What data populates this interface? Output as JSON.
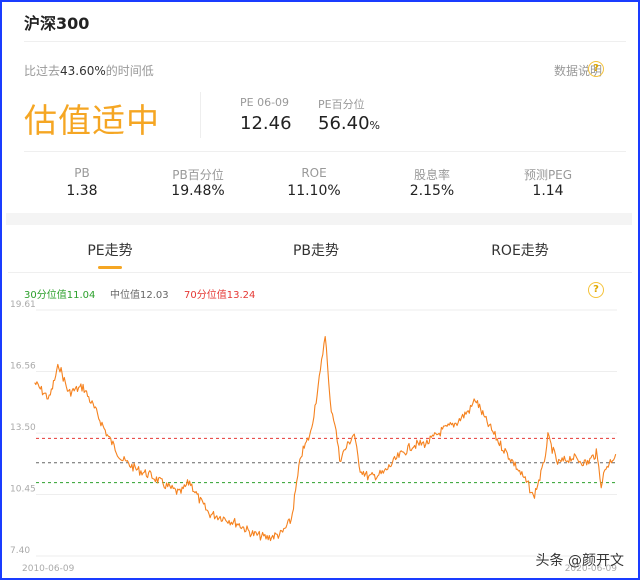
{
  "header": {
    "title": "沪深300"
  },
  "summary": {
    "compare_prefix": "比过去",
    "compare_value": "43.60%",
    "compare_suffix": "的时间低",
    "explain_label": "数据说明",
    "help_icon": "?",
    "verdict": "估值适中",
    "verdict_color": "#f5a623",
    "pe_label": "PE 06-09",
    "pe_value": "12.46",
    "pe_pct_label": "PE百分位",
    "pe_pct_value": "56.40",
    "pe_pct_unit": "%"
  },
  "metrics": [
    {
      "label": "PB",
      "value": "1.38"
    },
    {
      "label": "PB百分位",
      "value": "19.48%"
    },
    {
      "label": "ROE",
      "value": "11.10%"
    },
    {
      "label": "股息率",
      "value": "2.15%"
    },
    {
      "label": "预测PEG",
      "value": "1.14"
    }
  ],
  "tabs": [
    {
      "label": "PE走势",
      "active": true
    },
    {
      "label": "PB走势",
      "active": false
    },
    {
      "label": "ROE走势",
      "active": false
    }
  ],
  "legend": [
    {
      "text": "30分位值11.04",
      "color": "#2ca02c"
    },
    {
      "text": "中位值12.03",
      "color": "#666666"
    },
    {
      "text": "70分位值13.24",
      "color": "#e53935"
    }
  ],
  "watermark": "头条 @颜开文",
  "chart_data": {
    "type": "line",
    "y_ticks": [
      "19.61",
      "16.56",
      "13.50",
      "10.45",
      "7.40"
    ],
    "ylim": [
      7.4,
      19.61
    ],
    "x_tick_labels": [
      "2010-06-09",
      "2020-06-09"
    ],
    "xlim": [
      "2010-06-09",
      "2020-06-09"
    ],
    "line_color": "#f5821f",
    "reference_lines": [
      {
        "name": "30分位值",
        "value": 11.04,
        "color": "#2ca02c"
      },
      {
        "name": "中位值",
        "value": 12.03,
        "color": "#666666"
      },
      {
        "name": "70分位值",
        "value": 13.24,
        "color": "#e53935"
      }
    ],
    "series": [
      {
        "x": [
          "2010-06",
          "2010-09",
          "2010-11",
          "2011-01",
          "2011-04",
          "2011-07",
          "2011-09",
          "2011-12",
          "2012-03",
          "2012-06",
          "2012-09",
          "2012-12",
          "2013-02",
          "2013-04",
          "2013-06",
          "2013-09",
          "2013-12",
          "2014-03",
          "2014-06",
          "2014-09",
          "2014-11",
          "2015-01",
          "2015-03",
          "2015-05",
          "2015-06",
          "2015-07",
          "2015-08",
          "2015-09",
          "2015-12",
          "2016-01",
          "2016-03",
          "2016-06",
          "2016-09",
          "2016-12",
          "2017-03",
          "2017-06",
          "2017-09",
          "2017-12",
          "2018-01",
          "2018-03",
          "2018-06",
          "2018-09",
          "2018-12",
          "2019-01",
          "2019-03",
          "2019-04",
          "2019-06",
          "2019-09",
          "2019-12",
          "2020-02",
          "2020-03",
          "2020-04",
          "2020-06"
        ],
        "values": [
          16.0,
          15.2,
          16.9,
          15.5,
          15.8,
          14.4,
          13.4,
          12.2,
          11.7,
          11.4,
          10.9,
          10.5,
          11.1,
          10.2,
          9.5,
          9.3,
          9.0,
          8.5,
          8.3,
          8.5,
          9.2,
          12.4,
          13.5,
          16.5,
          18.5,
          15.0,
          14.0,
          12.2,
          13.5,
          11.8,
          11.3,
          11.5,
          12.3,
          12.9,
          13.0,
          13.6,
          14.0,
          14.7,
          15.2,
          14.2,
          13.0,
          12.0,
          10.9,
          10.3,
          11.8,
          13.3,
          12.0,
          12.3,
          12.0,
          12.5,
          11.0,
          11.8,
          12.46
        ]
      }
    ]
  }
}
